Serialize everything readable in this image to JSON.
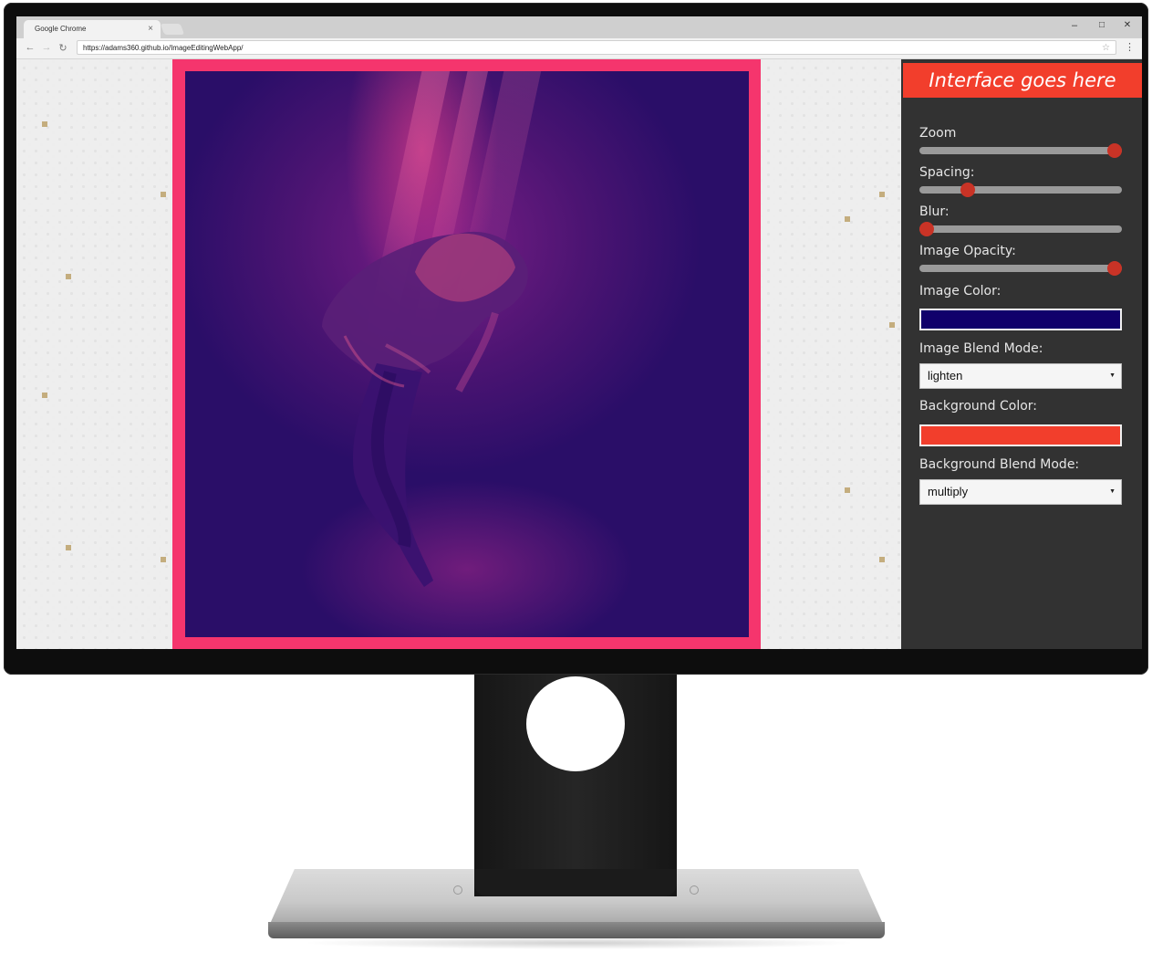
{
  "browser": {
    "tab_title": "Google Chrome",
    "tab_close": "×",
    "url": "https://adams360.github.io/ImageEditingWebApp/",
    "window_controls": {
      "minimize": "–",
      "maximize": "□",
      "close": "✕"
    },
    "nav": {
      "back": "←",
      "forward": "→",
      "reload": "↻"
    },
    "star": "☆",
    "menu": "⋮"
  },
  "panel": {
    "title": "Interface goes here",
    "controls": {
      "zoom": {
        "label": "Zoom",
        "value": 1.0
      },
      "spacing": {
        "label": "Spacing:",
        "value": 0.22
      },
      "blur": {
        "label": "Blur:",
        "value": 0.0
      },
      "image_opacity": {
        "label": "Image Opacity:",
        "value": 1.0
      },
      "image_color": {
        "label": "Image Color:",
        "color": "#10006b"
      },
      "image_blend_mode": {
        "label": "Image Blend Mode:",
        "selected": "lighten"
      },
      "background_color": {
        "label": "Background Color:",
        "color": "#f23e2c"
      },
      "background_blend_mode": {
        "label": "Background Blend Mode:",
        "selected": "multiply"
      }
    },
    "select_arrow": "▼"
  },
  "colors": {
    "frame": "#f5356d",
    "panel_bg": "#323232",
    "header": "#f23e2c",
    "slider_thumb": "#c93326",
    "accent_gold": "#c4ad7e"
  }
}
